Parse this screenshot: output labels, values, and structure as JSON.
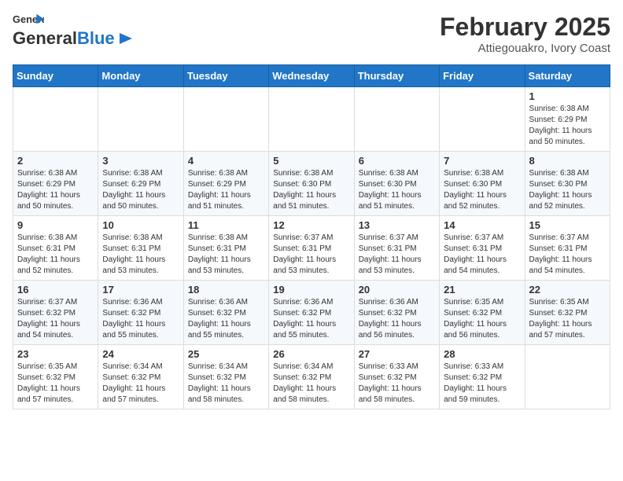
{
  "header": {
    "logo_line1": "General",
    "logo_line2": "Blue",
    "title": "February 2025",
    "subtitle": "Attiegouakro, Ivory Coast"
  },
  "weekdays": [
    "Sunday",
    "Monday",
    "Tuesday",
    "Wednesday",
    "Thursday",
    "Friday",
    "Saturday"
  ],
  "weeks": [
    [
      {
        "day": "",
        "info": ""
      },
      {
        "day": "",
        "info": ""
      },
      {
        "day": "",
        "info": ""
      },
      {
        "day": "",
        "info": ""
      },
      {
        "day": "",
        "info": ""
      },
      {
        "day": "",
        "info": ""
      },
      {
        "day": "1",
        "info": "Sunrise: 6:38 AM\nSunset: 6:29 PM\nDaylight: 11 hours and 50 minutes."
      }
    ],
    [
      {
        "day": "2",
        "info": "Sunrise: 6:38 AM\nSunset: 6:29 PM\nDaylight: 11 hours and 50 minutes."
      },
      {
        "day": "3",
        "info": "Sunrise: 6:38 AM\nSunset: 6:29 PM\nDaylight: 11 hours and 50 minutes."
      },
      {
        "day": "4",
        "info": "Sunrise: 6:38 AM\nSunset: 6:29 PM\nDaylight: 11 hours and 51 minutes."
      },
      {
        "day": "5",
        "info": "Sunrise: 6:38 AM\nSunset: 6:30 PM\nDaylight: 11 hours and 51 minutes."
      },
      {
        "day": "6",
        "info": "Sunrise: 6:38 AM\nSunset: 6:30 PM\nDaylight: 11 hours and 51 minutes."
      },
      {
        "day": "7",
        "info": "Sunrise: 6:38 AM\nSunset: 6:30 PM\nDaylight: 11 hours and 52 minutes."
      },
      {
        "day": "8",
        "info": "Sunrise: 6:38 AM\nSunset: 6:30 PM\nDaylight: 11 hours and 52 minutes."
      }
    ],
    [
      {
        "day": "9",
        "info": "Sunrise: 6:38 AM\nSunset: 6:31 PM\nDaylight: 11 hours and 52 minutes."
      },
      {
        "day": "10",
        "info": "Sunrise: 6:38 AM\nSunset: 6:31 PM\nDaylight: 11 hours and 53 minutes."
      },
      {
        "day": "11",
        "info": "Sunrise: 6:38 AM\nSunset: 6:31 PM\nDaylight: 11 hours and 53 minutes."
      },
      {
        "day": "12",
        "info": "Sunrise: 6:37 AM\nSunset: 6:31 PM\nDaylight: 11 hours and 53 minutes."
      },
      {
        "day": "13",
        "info": "Sunrise: 6:37 AM\nSunset: 6:31 PM\nDaylight: 11 hours and 53 minutes."
      },
      {
        "day": "14",
        "info": "Sunrise: 6:37 AM\nSunset: 6:31 PM\nDaylight: 11 hours and 54 minutes."
      },
      {
        "day": "15",
        "info": "Sunrise: 6:37 AM\nSunset: 6:31 PM\nDaylight: 11 hours and 54 minutes."
      }
    ],
    [
      {
        "day": "16",
        "info": "Sunrise: 6:37 AM\nSunset: 6:32 PM\nDaylight: 11 hours and 54 minutes."
      },
      {
        "day": "17",
        "info": "Sunrise: 6:36 AM\nSunset: 6:32 PM\nDaylight: 11 hours and 55 minutes."
      },
      {
        "day": "18",
        "info": "Sunrise: 6:36 AM\nSunset: 6:32 PM\nDaylight: 11 hours and 55 minutes."
      },
      {
        "day": "19",
        "info": "Sunrise: 6:36 AM\nSunset: 6:32 PM\nDaylight: 11 hours and 55 minutes."
      },
      {
        "day": "20",
        "info": "Sunrise: 6:36 AM\nSunset: 6:32 PM\nDaylight: 11 hours and 56 minutes."
      },
      {
        "day": "21",
        "info": "Sunrise: 6:35 AM\nSunset: 6:32 PM\nDaylight: 11 hours and 56 minutes."
      },
      {
        "day": "22",
        "info": "Sunrise: 6:35 AM\nSunset: 6:32 PM\nDaylight: 11 hours and 57 minutes."
      }
    ],
    [
      {
        "day": "23",
        "info": "Sunrise: 6:35 AM\nSunset: 6:32 PM\nDaylight: 11 hours and 57 minutes."
      },
      {
        "day": "24",
        "info": "Sunrise: 6:34 AM\nSunset: 6:32 PM\nDaylight: 11 hours and 57 minutes."
      },
      {
        "day": "25",
        "info": "Sunrise: 6:34 AM\nSunset: 6:32 PM\nDaylight: 11 hours and 58 minutes."
      },
      {
        "day": "26",
        "info": "Sunrise: 6:34 AM\nSunset: 6:32 PM\nDaylight: 11 hours and 58 minutes."
      },
      {
        "day": "27",
        "info": "Sunrise: 6:33 AM\nSunset: 6:32 PM\nDaylight: 11 hours and 58 minutes."
      },
      {
        "day": "28",
        "info": "Sunrise: 6:33 AM\nSunset: 6:32 PM\nDaylight: 11 hours and 59 minutes."
      },
      {
        "day": "",
        "info": ""
      }
    ]
  ]
}
